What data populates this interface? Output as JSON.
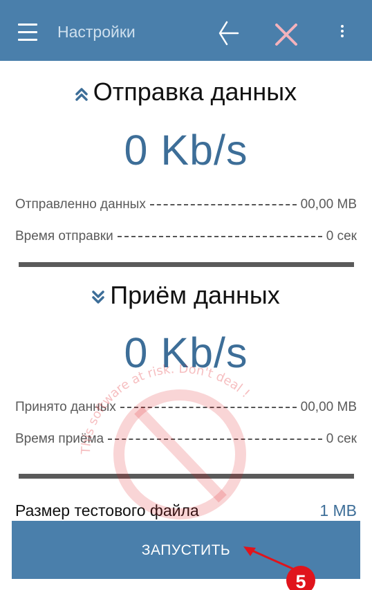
{
  "appbar": {
    "title": "Настройки",
    "menu_icon": "hamburger-menu-icon",
    "back_icon": "back-arrow-icon",
    "close_icon": "close-icon",
    "more_icon": "more-vert-icon",
    "color": "#4a7fab"
  },
  "upload": {
    "title": "Отправка данных",
    "icon": "double-chevron-up-icon",
    "speed": "0 Kb/s",
    "sent_label": "Отправленно данных",
    "sent_value": "00,00 MB",
    "time_label": "Время отправки",
    "time_value": "0 сек"
  },
  "download": {
    "title": "Приём данных",
    "icon": "double-chevron-down-icon",
    "speed": "0 Kb/s",
    "received_label": "Принято данных",
    "received_value": "00,00 MB",
    "time_label": "Время приёма",
    "time_value": "0 сек"
  },
  "file_size": {
    "label": "Размер тестового файла",
    "value": "1 MB"
  },
  "start_button": {
    "label": "ЗАПУСТИТЬ"
  },
  "watermark": {
    "text": "This software at risk. Don't deal !",
    "color": "#e0141c"
  },
  "annotation": {
    "step": "5",
    "color": "#e0141c"
  }
}
